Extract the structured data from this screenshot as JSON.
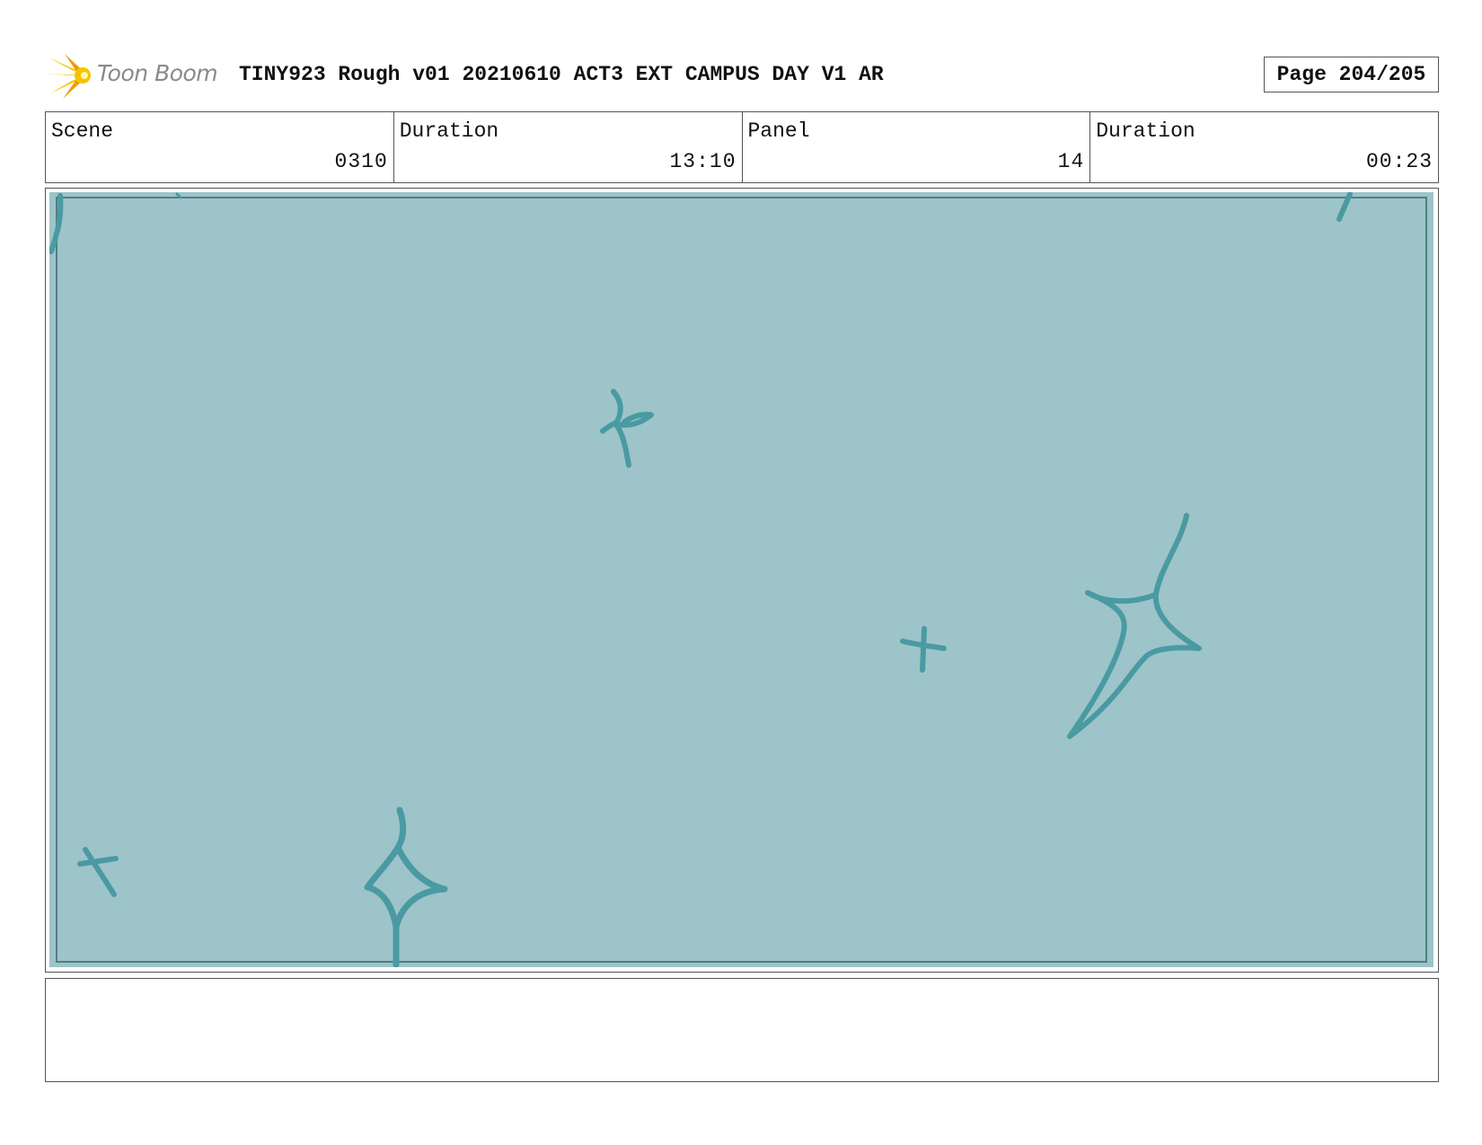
{
  "header": {
    "logo_text": "Toon Boom",
    "title": "TINY923 Rough v01 20210610 ACT3 EXT CAMPUS DAY V1 AR",
    "page": "Page 204/205"
  },
  "info": {
    "scene_label": "Scene",
    "scene_value": "0310",
    "scene_duration_label": "Duration",
    "scene_duration_value": "13:10",
    "panel_label": "Panel",
    "panel_value": "14",
    "panel_duration_label": "Duration",
    "panel_duration_value": "00:23"
  },
  "panel": {
    "background_color": "#9dc4c8",
    "stroke_color": "#4a9aa3",
    "border_color": "#4f7f85"
  },
  "notes": {
    "text": ""
  },
  "colors": {
    "logo_yellow": "#f5c400",
    "logo_orange": "#f39a00"
  }
}
